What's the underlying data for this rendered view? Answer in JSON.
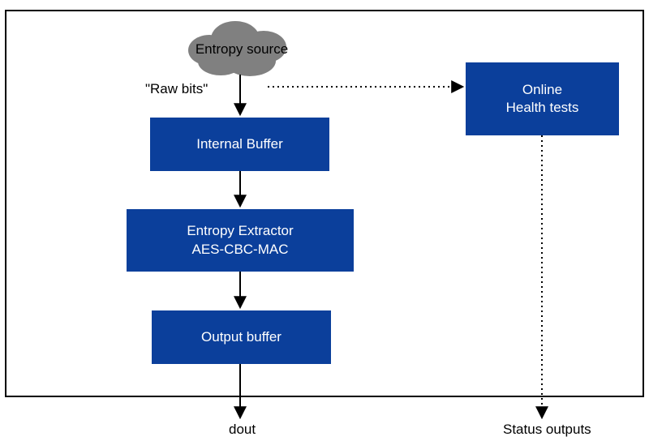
{
  "diagram": {
    "frame_color": "#000000",
    "box_color": "#0b3f9b",
    "cloud_color": "#808080",
    "nodes": {
      "entropy_source": {
        "label": "Entropy source",
        "shape": "cloud"
      },
      "internal_buffer": {
        "label": "Internal Buffer",
        "shape": "rect"
      },
      "entropy_extractor": {
        "label": "Entropy Extractor\nAES-CBC-MAC",
        "shape": "rect"
      },
      "output_buffer": {
        "label": "Output buffer",
        "shape": "rect"
      },
      "health_tests": {
        "label": "Online\nHealth tests",
        "shape": "rect"
      }
    },
    "edge_labels": {
      "raw_bits": "\"Raw bits\""
    },
    "outputs": {
      "dout": "dout",
      "status": "Status outputs"
    },
    "edges": [
      {
        "from": "entropy_source",
        "to": "internal_buffer",
        "style": "solid"
      },
      {
        "from": "entropy_source",
        "to": "health_tests",
        "style": "dotted",
        "label_ref": "raw_bits"
      },
      {
        "from": "internal_buffer",
        "to": "entropy_extractor",
        "style": "solid"
      },
      {
        "from": "entropy_extractor",
        "to": "output_buffer",
        "style": "solid"
      },
      {
        "from": "output_buffer",
        "to": "dout",
        "style": "solid",
        "exits_frame": true
      },
      {
        "from": "health_tests",
        "to": "status",
        "style": "dotted",
        "exits_frame": true
      }
    ]
  },
  "chart_data": {
    "type": "diagram",
    "title": "",
    "nodes": [
      {
        "id": "entropy_source",
        "label": "Entropy source",
        "shape": "cloud",
        "fill": "#808080"
      },
      {
        "id": "internal_buffer",
        "label": "Internal Buffer",
        "shape": "rect",
        "fill": "#0b3f9b"
      },
      {
        "id": "entropy_extractor",
        "label": "Entropy Extractor AES-CBC-MAC",
        "shape": "rect",
        "fill": "#0b3f9b"
      },
      {
        "id": "output_buffer",
        "label": "Output buffer",
        "shape": "rect",
        "fill": "#0b3f9b"
      },
      {
        "id": "health_tests",
        "label": "Online Health tests",
        "shape": "rect",
        "fill": "#0b3f9b"
      },
      {
        "id": "dout",
        "label": "dout",
        "shape": "output"
      },
      {
        "id": "status",
        "label": "Status outputs",
        "shape": "output"
      }
    ],
    "edges": [
      {
        "from": "entropy_source",
        "to": "internal_buffer",
        "style": "solid",
        "label": "\"Raw bits\""
      },
      {
        "from": "entropy_source",
        "to": "health_tests",
        "style": "dotted"
      },
      {
        "from": "internal_buffer",
        "to": "entropy_extractor",
        "style": "solid"
      },
      {
        "from": "entropy_extractor",
        "to": "output_buffer",
        "style": "solid"
      },
      {
        "from": "output_buffer",
        "to": "dout",
        "style": "solid"
      },
      {
        "from": "health_tests",
        "to": "status",
        "style": "dotted"
      }
    ]
  }
}
